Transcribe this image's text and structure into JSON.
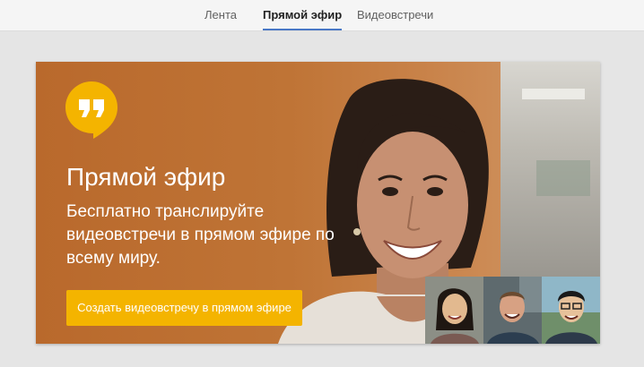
{
  "tabs": [
    {
      "label": "Лента"
    },
    {
      "label": "Прямой эфир",
      "active": true
    },
    {
      "label": "Видеовстречи"
    }
  ],
  "promo": {
    "title": "Прямой эфир",
    "subtitle": "Бесплатно транслируйте видеовстречи в прямом эфире по всему миру.",
    "cta_label": "Создать видеовстречу в прямом эфире",
    "logo_icon": "hangouts-quote-icon"
  },
  "colors": {
    "accent": "#4a78c6",
    "cta": "#f4b400",
    "logo": "#f4b400",
    "banner": "#b86a2f"
  }
}
